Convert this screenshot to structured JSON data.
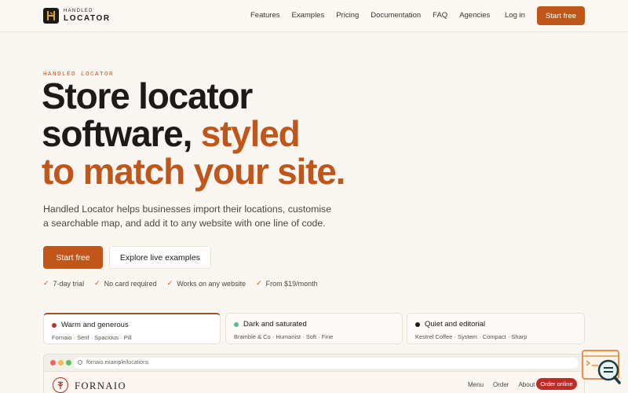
{
  "brand": {
    "small": "HANDLED",
    "big": "LOCATOR"
  },
  "nav": {
    "links": [
      "Features",
      "Examples",
      "Pricing",
      "Documentation",
      "FAQ",
      "Agencies"
    ],
    "login": "Log in",
    "cta": "Start free"
  },
  "hero": {
    "eyebrow": "HANDLED LOCATOR",
    "line1": "Store locator",
    "line2_plain": "software, ",
    "line2_accent": "styled",
    "line3_accent": "to match your site.",
    "subtitle": "Handled Locator helps businesses import their locations, customise a searchable map, and add it to any website with one line of code.",
    "primary_cta": "Start free",
    "secondary_cta": "Explore live examples",
    "checks": [
      "7-day trial",
      "No card required",
      "Works on any website",
      "From $19/month"
    ]
  },
  "themes": [
    {
      "title": "Warm and generous",
      "meta": "Fornaio · Serif · Spacious · Pill",
      "color": "#c62f22"
    },
    {
      "title": "Dark and saturated",
      "meta": "Bramble & Co · Humanist · Soft · Fine",
      "color": "#4fc08d"
    },
    {
      "title": "Quiet and editorial",
      "meta": "Kestrel Coffee · System · Compact · Sharp",
      "color": "#1d1b18"
    }
  ],
  "preview": {
    "url": "fornaio.example/locations",
    "site_name": "FORNAIO",
    "site_nav": [
      "Menu",
      "Order",
      "About"
    ],
    "order_btn": "Order online"
  },
  "colors": {
    "accent": "#c0561a",
    "ink": "#1d1b18",
    "background": "#faf7f3"
  }
}
